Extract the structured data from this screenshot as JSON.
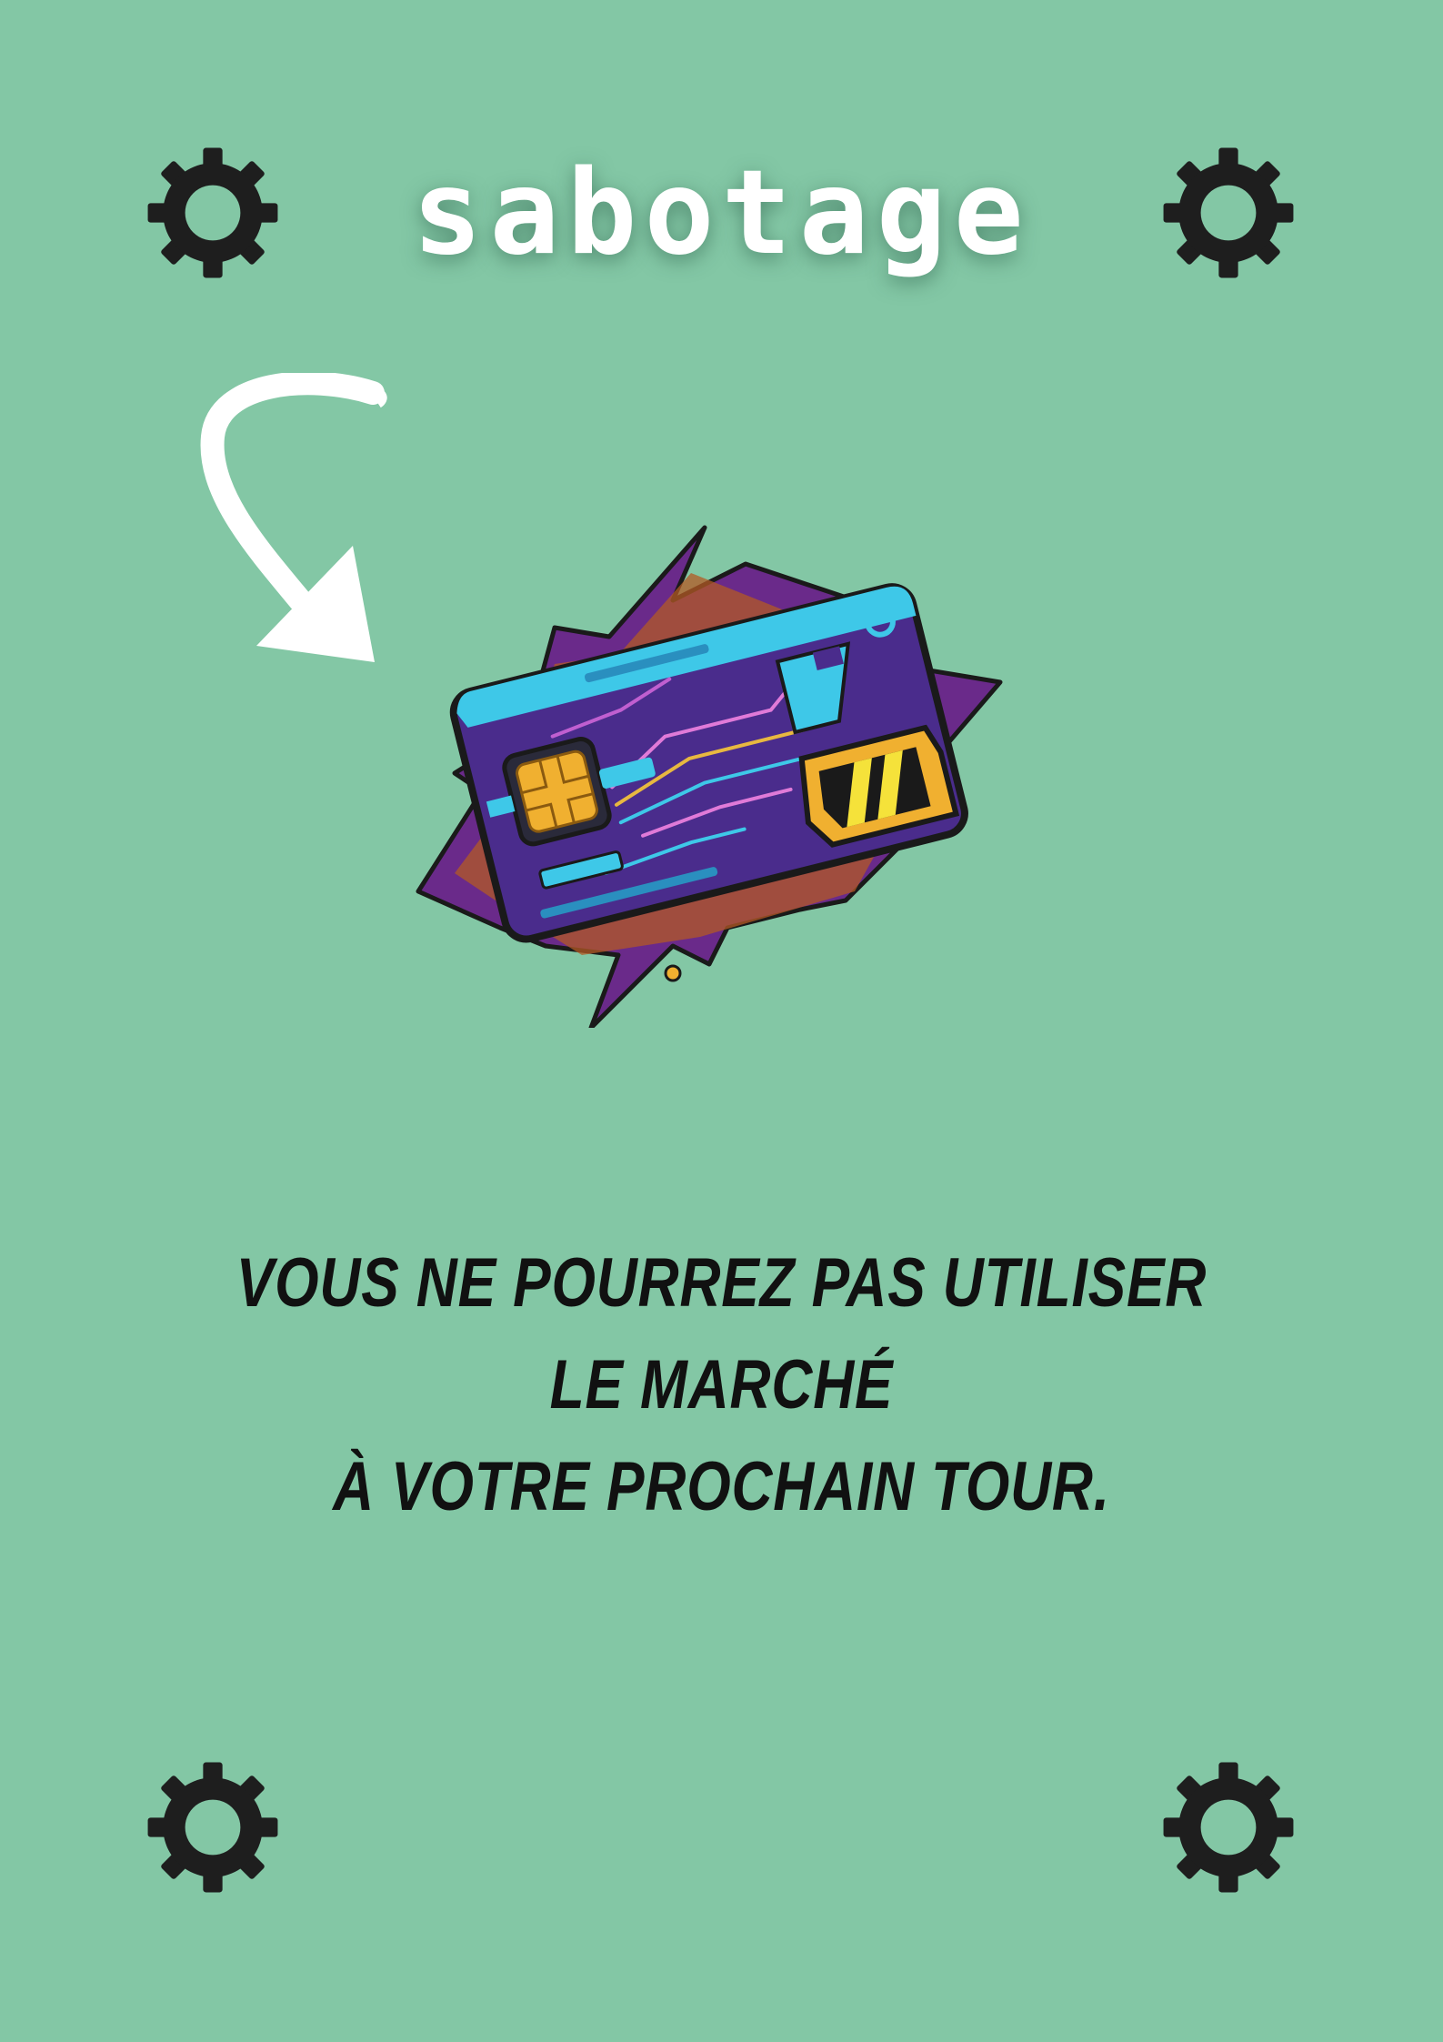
{
  "card": {
    "title": "SABOTAGE",
    "message_lines": [
      "VOUS NE POURREZ PAS UTILISER LE MARCHÉ",
      "À VOTRE PROCHAIN TOUR."
    ]
  },
  "icons": {
    "corner_decoration": "gear-icon",
    "pointer": "curved-arrow-icon",
    "illustration": "sim-card-icon"
  },
  "colors": {
    "background": "#83c7a5",
    "title_text": "#ffffff",
    "message_text": "#111111",
    "gear": "#1e1e1e"
  }
}
